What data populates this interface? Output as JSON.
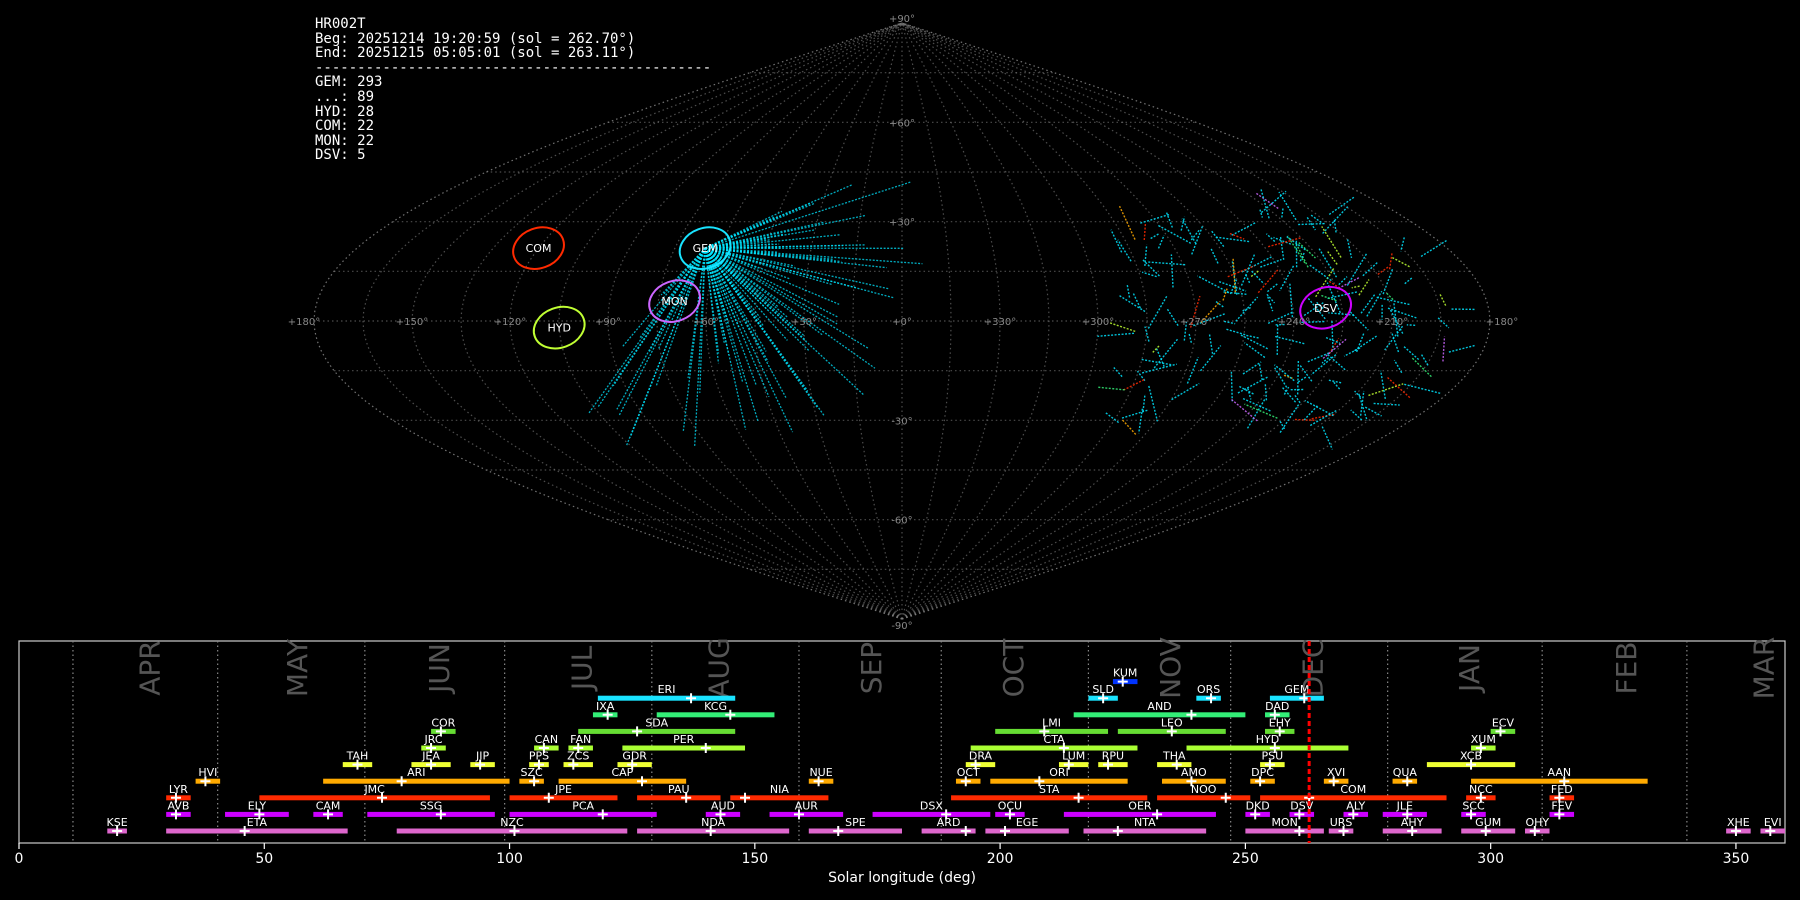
{
  "info": {
    "station": "HR002T",
    "begin": "Beg: 20251214 19:20:59 (sol = 262.70°)",
    "end": "End: 20251215 05:05:01 (sol = 263.11°)",
    "separator": "-----------------------------------------------",
    "counts": [
      "GEM: 293",
      "...: 89",
      "HYD: 28",
      "COM: 22",
      "MON: 22",
      "DSV: 5"
    ]
  },
  "colors": {
    "background": "#000000",
    "grid": "#808080",
    "sporadic": "#00e5ff",
    "current_sol": "#ff0000"
  },
  "chart_data": [
    {
      "type": "scatter",
      "title": "",
      "projection": "sinusoidal",
      "lon_labels": [
        "+180°",
        "+150°",
        "+120°",
        "+90°",
        "+60°",
        "+30°",
        "+0°",
        "+330°",
        "+300°",
        "+270°",
        "+240°",
        "+210°",
        "+180°"
      ],
      "lat_labels": [
        "+90°",
        "+60°",
        "+30°",
        "-30°",
        "-60°",
        "-90°"
      ],
      "radiants": [
        {
          "name": "COM",
          "lon": 120,
          "lat": 22,
          "color": "#ff2a00"
        },
        {
          "name": "GEM",
          "lon": 65,
          "lat": 22,
          "color": "#19e3ff"
        },
        {
          "name": "MON",
          "lon": 70,
          "lat": 6,
          "color": "#cc66ff"
        },
        {
          "name": "HYD",
          "lon": 105,
          "lat": -2,
          "color": "#c0ff33"
        },
        {
          "name": "DSV",
          "lon": 230,
          "lat": 4,
          "color": "#cc00ff"
        }
      ]
    },
    {
      "type": "bar",
      "xlabel": "Solar longitude (deg)",
      "ylabel": "",
      "xlim": [
        0,
        360
      ],
      "xticks": [
        0,
        50,
        100,
        150,
        200,
        250,
        300,
        350
      ],
      "current_sol": 263,
      "month_dividers": [
        11,
        40.5,
        70.5,
        99,
        129,
        159,
        188,
        218,
        247,
        279,
        310.5,
        340
      ],
      "months": [
        {
          "name": "APR",
          "sol": 25
        },
        {
          "name": "MAY",
          "sol": 55
        },
        {
          "name": "JUN",
          "sol": 84
        },
        {
          "name": "JUL",
          "sol": 113
        },
        {
          "name": "AUG",
          "sol": 141
        },
        {
          "name": "SEP",
          "sol": 172
        },
        {
          "name": "OCT",
          "sol": 201
        },
        {
          "name": "NOV",
          "sol": 233
        },
        {
          "name": "DEC",
          "sol": 262
        },
        {
          "name": "JAN",
          "sol": 294
        },
        {
          "name": "FEB",
          "sol": 326
        },
        {
          "name": "MAR",
          "sol": 354
        }
      ],
      "showers": [
        {
          "name": "KUM",
          "start": 223,
          "end": 228,
          "peak": 225,
          "row": 11,
          "color": "#0033ff"
        },
        {
          "name": "ERI",
          "start": 118,
          "end": 146,
          "peak": 137,
          "row": 10,
          "color": "#19e3ff"
        },
        {
          "name": "SLD",
          "start": 218,
          "end": 224,
          "peak": 221,
          "row": 10,
          "color": "#19e3ff"
        },
        {
          "name": "ORS",
          "start": 240,
          "end": 245,
          "peak": 243,
          "row": 10,
          "color": "#19e3ff"
        },
        {
          "name": "GEM",
          "start": 255,
          "end": 266,
          "peak": 262,
          "row": 10,
          "color": "#19e3ff"
        },
        {
          "name": "IXA",
          "start": 117,
          "end": 122,
          "peak": 120,
          "row": 9,
          "color": "#33ee77"
        },
        {
          "name": "KCG",
          "start": 130,
          "end": 154,
          "peak": 145,
          "row": 9,
          "color": "#33ee77"
        },
        {
          "name": "AND",
          "start": 215,
          "end": 250,
          "peak": 239,
          "row": 9,
          "color": "#33ee77"
        },
        {
          "name": "DAD",
          "start": 254,
          "end": 259,
          "peak": 256,
          "row": 9,
          "color": "#33ee77"
        },
        {
          "name": "COR",
          "start": 84,
          "end": 89,
          "peak": 86,
          "row": 8,
          "color": "#66dd33"
        },
        {
          "name": "SDA",
          "start": 114,
          "end": 146,
          "peak": 126,
          "row": 8,
          "color": "#66dd33"
        },
        {
          "name": "LMI",
          "start": 199,
          "end": 222,
          "peak": 209,
          "row": 8,
          "color": "#66dd33"
        },
        {
          "name": "LEO",
          "start": 224,
          "end": 246,
          "peak": 235,
          "row": 8,
          "color": "#66dd33"
        },
        {
          "name": "EHY",
          "start": 254,
          "end": 260,
          "peak": 257,
          "row": 8,
          "color": "#66dd33"
        },
        {
          "name": "ECV",
          "start": 300,
          "end": 305,
          "peak": 302,
          "row": 8,
          "color": "#66dd33"
        },
        {
          "name": "JRC",
          "start": 82,
          "end": 87,
          "peak": 84,
          "row": 7,
          "color": "#aaff33"
        },
        {
          "name": "CAN",
          "start": 105,
          "end": 110,
          "peak": 107,
          "row": 7,
          "color": "#aaff33"
        },
        {
          "name": "FAN",
          "start": 112,
          "end": 117,
          "peak": 114,
          "row": 7,
          "color": "#aaff33"
        },
        {
          "name": "PER",
          "start": 123,
          "end": 148,
          "peak": 140,
          "row": 7,
          "color": "#aaff33"
        },
        {
          "name": "CTA",
          "start": 194,
          "end": 228,
          "peak": 213,
          "row": 7,
          "color": "#aaff33"
        },
        {
          "name": "HYD",
          "start": 238,
          "end": 271,
          "peak": 256,
          "row": 7,
          "color": "#aaff33"
        },
        {
          "name": "XUM",
          "start": 296,
          "end": 301,
          "peak": 298,
          "row": 7,
          "color": "#aaff33"
        },
        {
          "name": "TAH",
          "start": 66,
          "end": 72,
          "peak": 69,
          "row": 6,
          "color": "#eeff33"
        },
        {
          "name": "JEA",
          "start": 80,
          "end": 88,
          "peak": 84,
          "row": 6,
          "color": "#eeff33"
        },
        {
          "name": "JIP",
          "start": 92,
          "end": 97,
          "peak": 94,
          "row": 6,
          "color": "#eeff33"
        },
        {
          "name": "PPS",
          "start": 104,
          "end": 108,
          "peak": 106,
          "row": 6,
          "color": "#eeff33"
        },
        {
          "name": "ZCS",
          "start": 111,
          "end": 117,
          "peak": 113,
          "row": 6,
          "color": "#eeff33"
        },
        {
          "name": "GDR",
          "start": 122,
          "end": 129,
          "peak": 125,
          "row": 6,
          "color": "#eeff33"
        },
        {
          "name": "DRA",
          "start": 193,
          "end": 199,
          "peak": 195,
          "row": 6,
          "color": "#eeff33"
        },
        {
          "name": "LUM",
          "start": 212,
          "end": 218,
          "peak": 214,
          "row": 6,
          "color": "#eeff33"
        },
        {
          "name": "RPU",
          "start": 220,
          "end": 226,
          "peak": 222,
          "row": 6,
          "color": "#eeff33"
        },
        {
          "name": "THA",
          "start": 232,
          "end": 239,
          "peak": 236,
          "row": 6,
          "color": "#eeff33"
        },
        {
          "name": "PSU",
          "start": 253,
          "end": 258,
          "peak": 255,
          "row": 6,
          "color": "#eeff33"
        },
        {
          "name": "XCB",
          "start": 287,
          "end": 305,
          "peak": 296,
          "row": 6,
          "color": "#eeff33"
        },
        {
          "name": "HVI",
          "start": 36,
          "end": 41,
          "peak": 38,
          "row": 5,
          "color": "#ffaa00"
        },
        {
          "name": "ARI",
          "start": 62,
          "end": 100,
          "peak": 78,
          "row": 5,
          "color": "#ffaa00"
        },
        {
          "name": "SZC",
          "start": 102,
          "end": 107,
          "peak": 105,
          "row": 5,
          "color": "#ffaa00"
        },
        {
          "name": "CAP",
          "start": 110,
          "end": 136,
          "peak": 127,
          "row": 5,
          "color": "#ffaa00"
        },
        {
          "name": "NUE",
          "start": 161,
          "end": 166,
          "peak": 163,
          "row": 5,
          "color": "#ffaa00"
        },
        {
          "name": "OCT",
          "start": 191,
          "end": 196,
          "peak": 193,
          "row": 5,
          "color": "#ffaa00"
        },
        {
          "name": "ORI",
          "start": 198,
          "end": 226,
          "peak": 208,
          "row": 5,
          "color": "#ffaa00"
        },
        {
          "name": "AMO",
          "start": 233,
          "end": 246,
          "peak": 239,
          "row": 5,
          "color": "#ffaa00"
        },
        {
          "name": "DPC",
          "start": 251,
          "end": 256,
          "peak": 253,
          "row": 5,
          "color": "#ffaa00"
        },
        {
          "name": "XVI",
          "start": 266,
          "end": 271,
          "peak": 268,
          "row": 5,
          "color": "#ffaa00"
        },
        {
          "name": "QUA",
          "start": 280,
          "end": 285,
          "peak": 283,
          "row": 5,
          "color": "#ffaa00"
        },
        {
          "name": "AAN",
          "start": 296,
          "end": 332,
          "peak": 315,
          "row": 5,
          "color": "#ffaa00"
        },
        {
          "name": "LYR",
          "start": 30,
          "end": 35,
          "peak": 32,
          "row": 4,
          "color": "#ff2a00"
        },
        {
          "name": "JMC",
          "start": 49,
          "end": 96,
          "peak": 74,
          "row": 4,
          "color": "#ff2a00"
        },
        {
          "name": "JPE",
          "start": 100,
          "end": 122,
          "peak": 108,
          "row": 4,
          "color": "#ff2a00"
        },
        {
          "name": "PAU",
          "start": 126,
          "end": 143,
          "peak": 136,
          "row": 4,
          "color": "#ff2a00"
        },
        {
          "name": "NIA",
          "start": 145,
          "end": 165,
          "peak": 148,
          "row": 4,
          "color": "#ff2a00"
        },
        {
          "name": "STA",
          "start": 190,
          "end": 230,
          "peak": 216,
          "row": 4,
          "color": "#ff2a00"
        },
        {
          "name": "NOO",
          "start": 232,
          "end": 251,
          "peak": 246,
          "row": 4,
          "color": "#ff2a00"
        },
        {
          "name": "COM",
          "start": 253,
          "end": 291,
          "peak": 263,
          "row": 4,
          "color": "#ff2a00"
        },
        {
          "name": "NCC",
          "start": 295,
          "end": 301,
          "peak": 298,
          "row": 4,
          "color": "#ff2a00"
        },
        {
          "name": "FED",
          "start": 312,
          "end": 317,
          "peak": 314,
          "row": 4,
          "color": "#ff2a00"
        },
        {
          "name": "AVB",
          "start": 30,
          "end": 35,
          "peak": 32,
          "row": 3,
          "color": "#cc00ff"
        },
        {
          "name": "ELY",
          "start": 42,
          "end": 55,
          "peak": 49,
          "row": 3,
          "color": "#cc00ff"
        },
        {
          "name": "CAM",
          "start": 60,
          "end": 66,
          "peak": 63,
          "row": 3,
          "color": "#cc00ff"
        },
        {
          "name": "SSG",
          "start": 71,
          "end": 97,
          "peak": 86,
          "row": 3,
          "color": "#cc00ff"
        },
        {
          "name": "PCA",
          "start": 100,
          "end": 130,
          "peak": 119,
          "row": 3,
          "color": "#cc00ff"
        },
        {
          "name": "AUD",
          "start": 140,
          "end": 147,
          "peak": 143,
          "row": 3,
          "color": "#cc00ff"
        },
        {
          "name": "AUR",
          "start": 153,
          "end": 168,
          "peak": 159,
          "row": 3,
          "color": "#cc00ff"
        },
        {
          "name": "DSX",
          "start": 174,
          "end": 198,
          "peak": 189,
          "row": 3,
          "color": "#cc00ff"
        },
        {
          "name": "OCU",
          "start": 199,
          "end": 205,
          "peak": 202,
          "row": 3,
          "color": "#cc00ff"
        },
        {
          "name": "OER",
          "start": 213,
          "end": 244,
          "peak": 232,
          "row": 3,
          "color": "#cc00ff"
        },
        {
          "name": "DKD",
          "start": 250,
          "end": 255,
          "peak": 252,
          "row": 3,
          "color": "#cc00ff"
        },
        {
          "name": "DSV",
          "start": 259,
          "end": 264,
          "peak": 261,
          "row": 3,
          "color": "#cc00ff"
        },
        {
          "name": "ALY",
          "start": 270,
          "end": 275,
          "peak": 272,
          "row": 3,
          "color": "#cc00ff"
        },
        {
          "name": "JLE",
          "start": 278,
          "end": 287,
          "peak": 283,
          "row": 3,
          "color": "#cc00ff"
        },
        {
          "name": "SCC",
          "start": 294,
          "end": 299,
          "peak": 296,
          "row": 3,
          "color": "#cc00ff"
        },
        {
          "name": "FEV",
          "start": 312,
          "end": 317,
          "peak": 314,
          "row": 3,
          "color": "#cc00ff"
        },
        {
          "name": "KSE",
          "start": 18,
          "end": 22,
          "peak": 20,
          "row": 2,
          "color": "#dd66cc"
        },
        {
          "name": "ETA",
          "start": 30,
          "end": 67,
          "peak": 46,
          "row": 2,
          "color": "#dd66cc"
        },
        {
          "name": "NZC",
          "start": 77,
          "end": 124,
          "peak": 101,
          "row": 2,
          "color": "#dd66cc"
        },
        {
          "name": "NDA",
          "start": 126,
          "end": 157,
          "peak": 141,
          "row": 2,
          "color": "#dd66cc"
        },
        {
          "name": "SPE",
          "start": 161,
          "end": 180,
          "peak": 167,
          "row": 2,
          "color": "#dd66cc"
        },
        {
          "name": "ARD",
          "start": 184,
          "end": 195,
          "peak": 193,
          "row": 2,
          "color": "#dd66cc"
        },
        {
          "name": "EGE",
          "start": 197,
          "end": 214,
          "peak": 201,
          "row": 2,
          "color": "#dd66cc"
        },
        {
          "name": "NTA",
          "start": 217,
          "end": 242,
          "peak": 224,
          "row": 2,
          "color": "#dd66cc"
        },
        {
          "name": "MON",
          "start": 250,
          "end": 266,
          "peak": 261,
          "row": 2,
          "color": "#dd66cc"
        },
        {
          "name": "URS",
          "start": 267,
          "end": 272,
          "peak": 270,
          "row": 2,
          "color": "#dd66cc"
        },
        {
          "name": "AHY",
          "start": 278,
          "end": 290,
          "peak": 284,
          "row": 2,
          "color": "#dd66cc"
        },
        {
          "name": "GUM",
          "start": 294,
          "end": 305,
          "peak": 299,
          "row": 2,
          "color": "#dd66cc"
        },
        {
          "name": "OHY",
          "start": 307,
          "end": 312,
          "peak": 309,
          "row": 2,
          "color": "#dd66cc"
        },
        {
          "name": "XHE",
          "start": 348,
          "end": 353,
          "peak": 350,
          "row": 2,
          "color": "#dd66cc"
        },
        {
          "name": "EVI",
          "start": 355,
          "end": 360,
          "peak": 357,
          "row": 2,
          "color": "#dd66cc"
        }
      ]
    }
  ]
}
